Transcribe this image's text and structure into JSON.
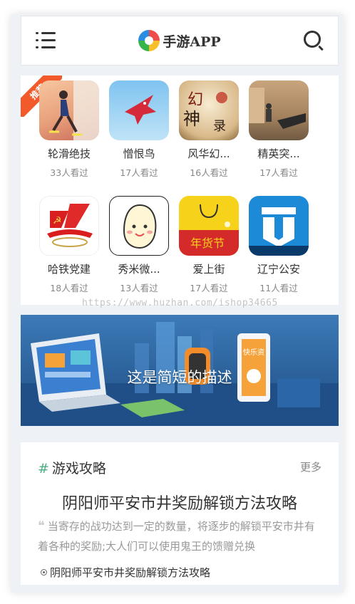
{
  "header": {
    "logo_text": "手游APP",
    "menu_icon": "menu-icon",
    "search_icon": "search-icon"
  },
  "featured_badge": "推荐",
  "apps": [
    {
      "name": "轮滑绝技",
      "views": "33人看过",
      "icon": "skater-game-icon"
    },
    {
      "name": "憎恨鸟",
      "views": "17人看过",
      "icon": "red-bird-icon"
    },
    {
      "name": "风华幻...",
      "views": "16人看过",
      "icon": "fantasy-game-icon"
    },
    {
      "name": "精英突...",
      "views": "17人看过",
      "icon": "shooter-game-icon"
    },
    {
      "name": "哈铁党建",
      "views": "18人看过",
      "icon": "party-emblem-icon"
    },
    {
      "name": "秀米微...",
      "views": "13人看过",
      "icon": "mascot-icon"
    },
    {
      "name": "爱上街",
      "views": "17人看过",
      "icon": "shopping-bag-icon"
    },
    {
      "name": "辽宁公安",
      "views": "11人看过",
      "icon": "police-logo-icon"
    }
  ],
  "watermark": "https://www.huzhan.com/ishop34665",
  "banner": {
    "caption": "这是简短的描述",
    "sign_text": "快乐资"
  },
  "article_section": {
    "title": "游戏攻略",
    "hash": "#",
    "more_label": "更多",
    "headline": "阴阳师平安市井奖励解锁方法攻略",
    "summary": "当寄存的战功达到一定的数量，将逐步的解锁平安市井有着各种的奖励;大人们可以使用鬼王的馈赠兑换",
    "list": [
      "阴阳师平安市井奖励解锁方法攻略"
    ]
  },
  "colors": {
    "accent": "#4cae84",
    "badge": "#f35a2b",
    "text": "#333333",
    "muted": "#888888"
  }
}
